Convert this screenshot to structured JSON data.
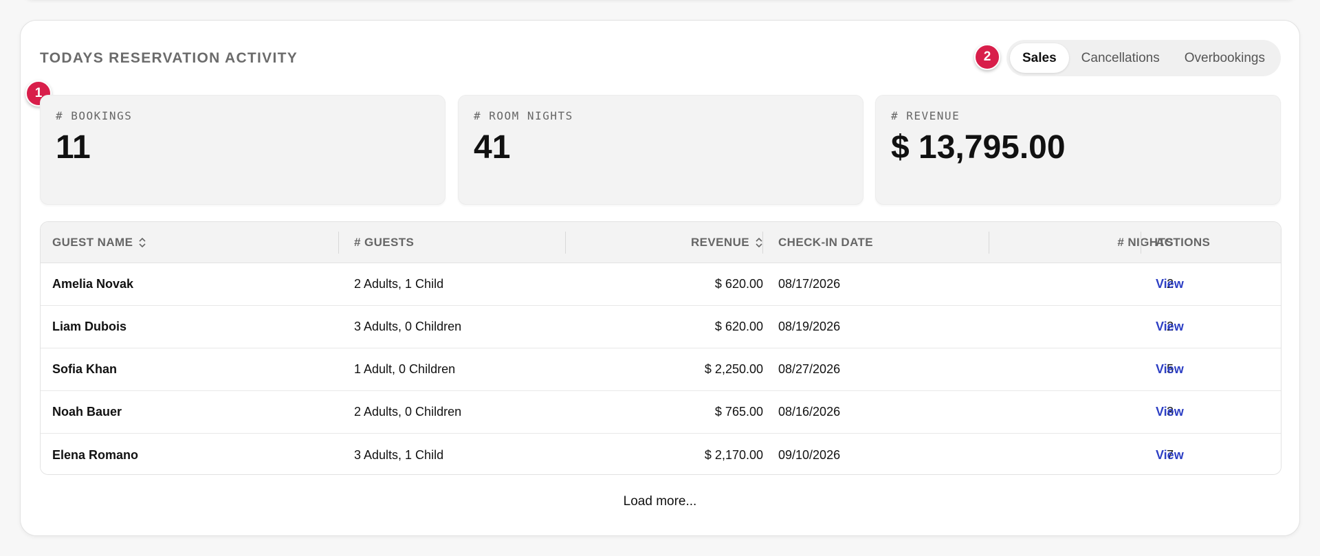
{
  "badges": {
    "first": "1",
    "second": "2"
  },
  "section": {
    "title": "TODAYS RESERVATION ACTIVITY"
  },
  "tabs": [
    {
      "label": "Sales",
      "active": true
    },
    {
      "label": "Cancellations",
      "active": false
    },
    {
      "label": "Overbookings",
      "active": false
    }
  ],
  "stats": {
    "bookings": {
      "label": "# BOOKINGS",
      "value": "11"
    },
    "room_nights": {
      "label": "# ROOM NIGHTS",
      "value": "41"
    },
    "revenue": {
      "label": "# REVENUE",
      "value": "$ 13,795.00"
    }
  },
  "table": {
    "headers": {
      "guest_name": "GUEST NAME",
      "guests": "# GUESTS",
      "revenue": "REVENUE",
      "checkin": "CHECK-IN DATE",
      "nights": "# NIGHTS",
      "actions": "ACTIONS"
    },
    "rows": [
      {
        "name": "Amelia Novak",
        "guests": "2 Adults, 1 Child",
        "revenue": "$ 620.00",
        "checkin": "08/17/2026",
        "nights": "2",
        "action": "View"
      },
      {
        "name": "Liam Dubois",
        "guests": "3 Adults, 0 Children",
        "revenue": "$ 620.00",
        "checkin": "08/19/2026",
        "nights": "2",
        "action": "View"
      },
      {
        "name": "Sofia Khan",
        "guests": "1 Adult, 0 Children",
        "revenue": "$ 2,250.00",
        "checkin": "08/27/2026",
        "nights": "5",
        "action": "View"
      },
      {
        "name": "Noah Bauer",
        "guests": "2 Adults, 0 Children",
        "revenue": "$ 765.00",
        "checkin": "08/16/2026",
        "nights": "3",
        "action": "View"
      },
      {
        "name": "Elena Romano",
        "guests": "3 Adults, 1 Child",
        "revenue": "$ 2,170.00",
        "checkin": "09/10/2026",
        "nights": "7",
        "action": "View"
      }
    ]
  },
  "footer": {
    "load_more": "Load more..."
  },
  "colors": {
    "accent": "#d81e4a",
    "link": "#2d3fc4"
  }
}
